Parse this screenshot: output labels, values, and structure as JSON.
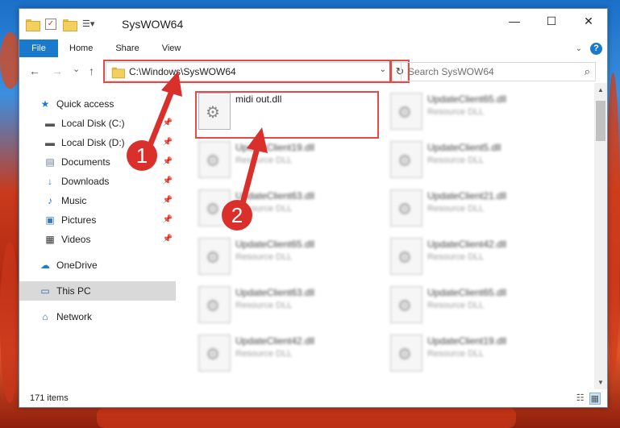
{
  "window": {
    "title": "SysWOW64",
    "controls": {
      "minimize": "—",
      "maximize": "☐",
      "close": "✕"
    }
  },
  "ribbon": {
    "file": "File",
    "tabs": [
      "Home",
      "Share",
      "View"
    ],
    "help": "?"
  },
  "nav": {
    "back": "←",
    "forward": "→",
    "recent": "⌄",
    "up": "↑",
    "address": "C:\\Windows\\SysWOW64",
    "search_placeholder": "Search SysWOW64"
  },
  "sidebar": {
    "quick_access": "Quick access",
    "items": [
      {
        "label": "Local Disk (C:)",
        "icon": "drive-icon"
      },
      {
        "label": "Local Disk (D:)",
        "icon": "drive-icon"
      },
      {
        "label": "Documents",
        "icon": "documents-icon"
      },
      {
        "label": "Downloads",
        "icon": "downloads-icon"
      },
      {
        "label": "Music",
        "icon": "music-icon"
      },
      {
        "label": "Pictures",
        "icon": "pictures-icon"
      },
      {
        "label": "Videos",
        "icon": "videos-icon"
      }
    ],
    "onedrive": "OneDrive",
    "this_pc": "This PC",
    "network": "Network"
  },
  "files": [
    {
      "name": "midi out.dll",
      "type": ""
    },
    {
      "name": "UpdateClient65.dll",
      "type": "Resource DLL"
    },
    {
      "name": "UpdateClient19.dll",
      "type": "Resource DLL"
    },
    {
      "name": "UpdateClient5.dll",
      "type": "Resource DLL"
    },
    {
      "name": "UpdateClient63.dll",
      "type": "Resource DLL"
    },
    {
      "name": "UpdateClient21.dll",
      "type": "Resource DLL"
    },
    {
      "name": "UpdateClient65.dll",
      "type": "Resource DLL"
    },
    {
      "name": "UpdateClient42.dll",
      "type": "Resource DLL"
    },
    {
      "name": "UpdateClient63.dll",
      "type": "Resource DLL"
    },
    {
      "name": "UpdateClient65.dll",
      "type": "Resource DLL"
    },
    {
      "name": "UpdateClient42.dll",
      "type": "Resource DLL"
    },
    {
      "name": "UpdateClient19.dll",
      "type": "Resource DLL"
    }
  ],
  "status": {
    "item_count": "171 items"
  },
  "annotations": {
    "step1": "1",
    "step2": "2",
    "color": "#d9302b"
  }
}
